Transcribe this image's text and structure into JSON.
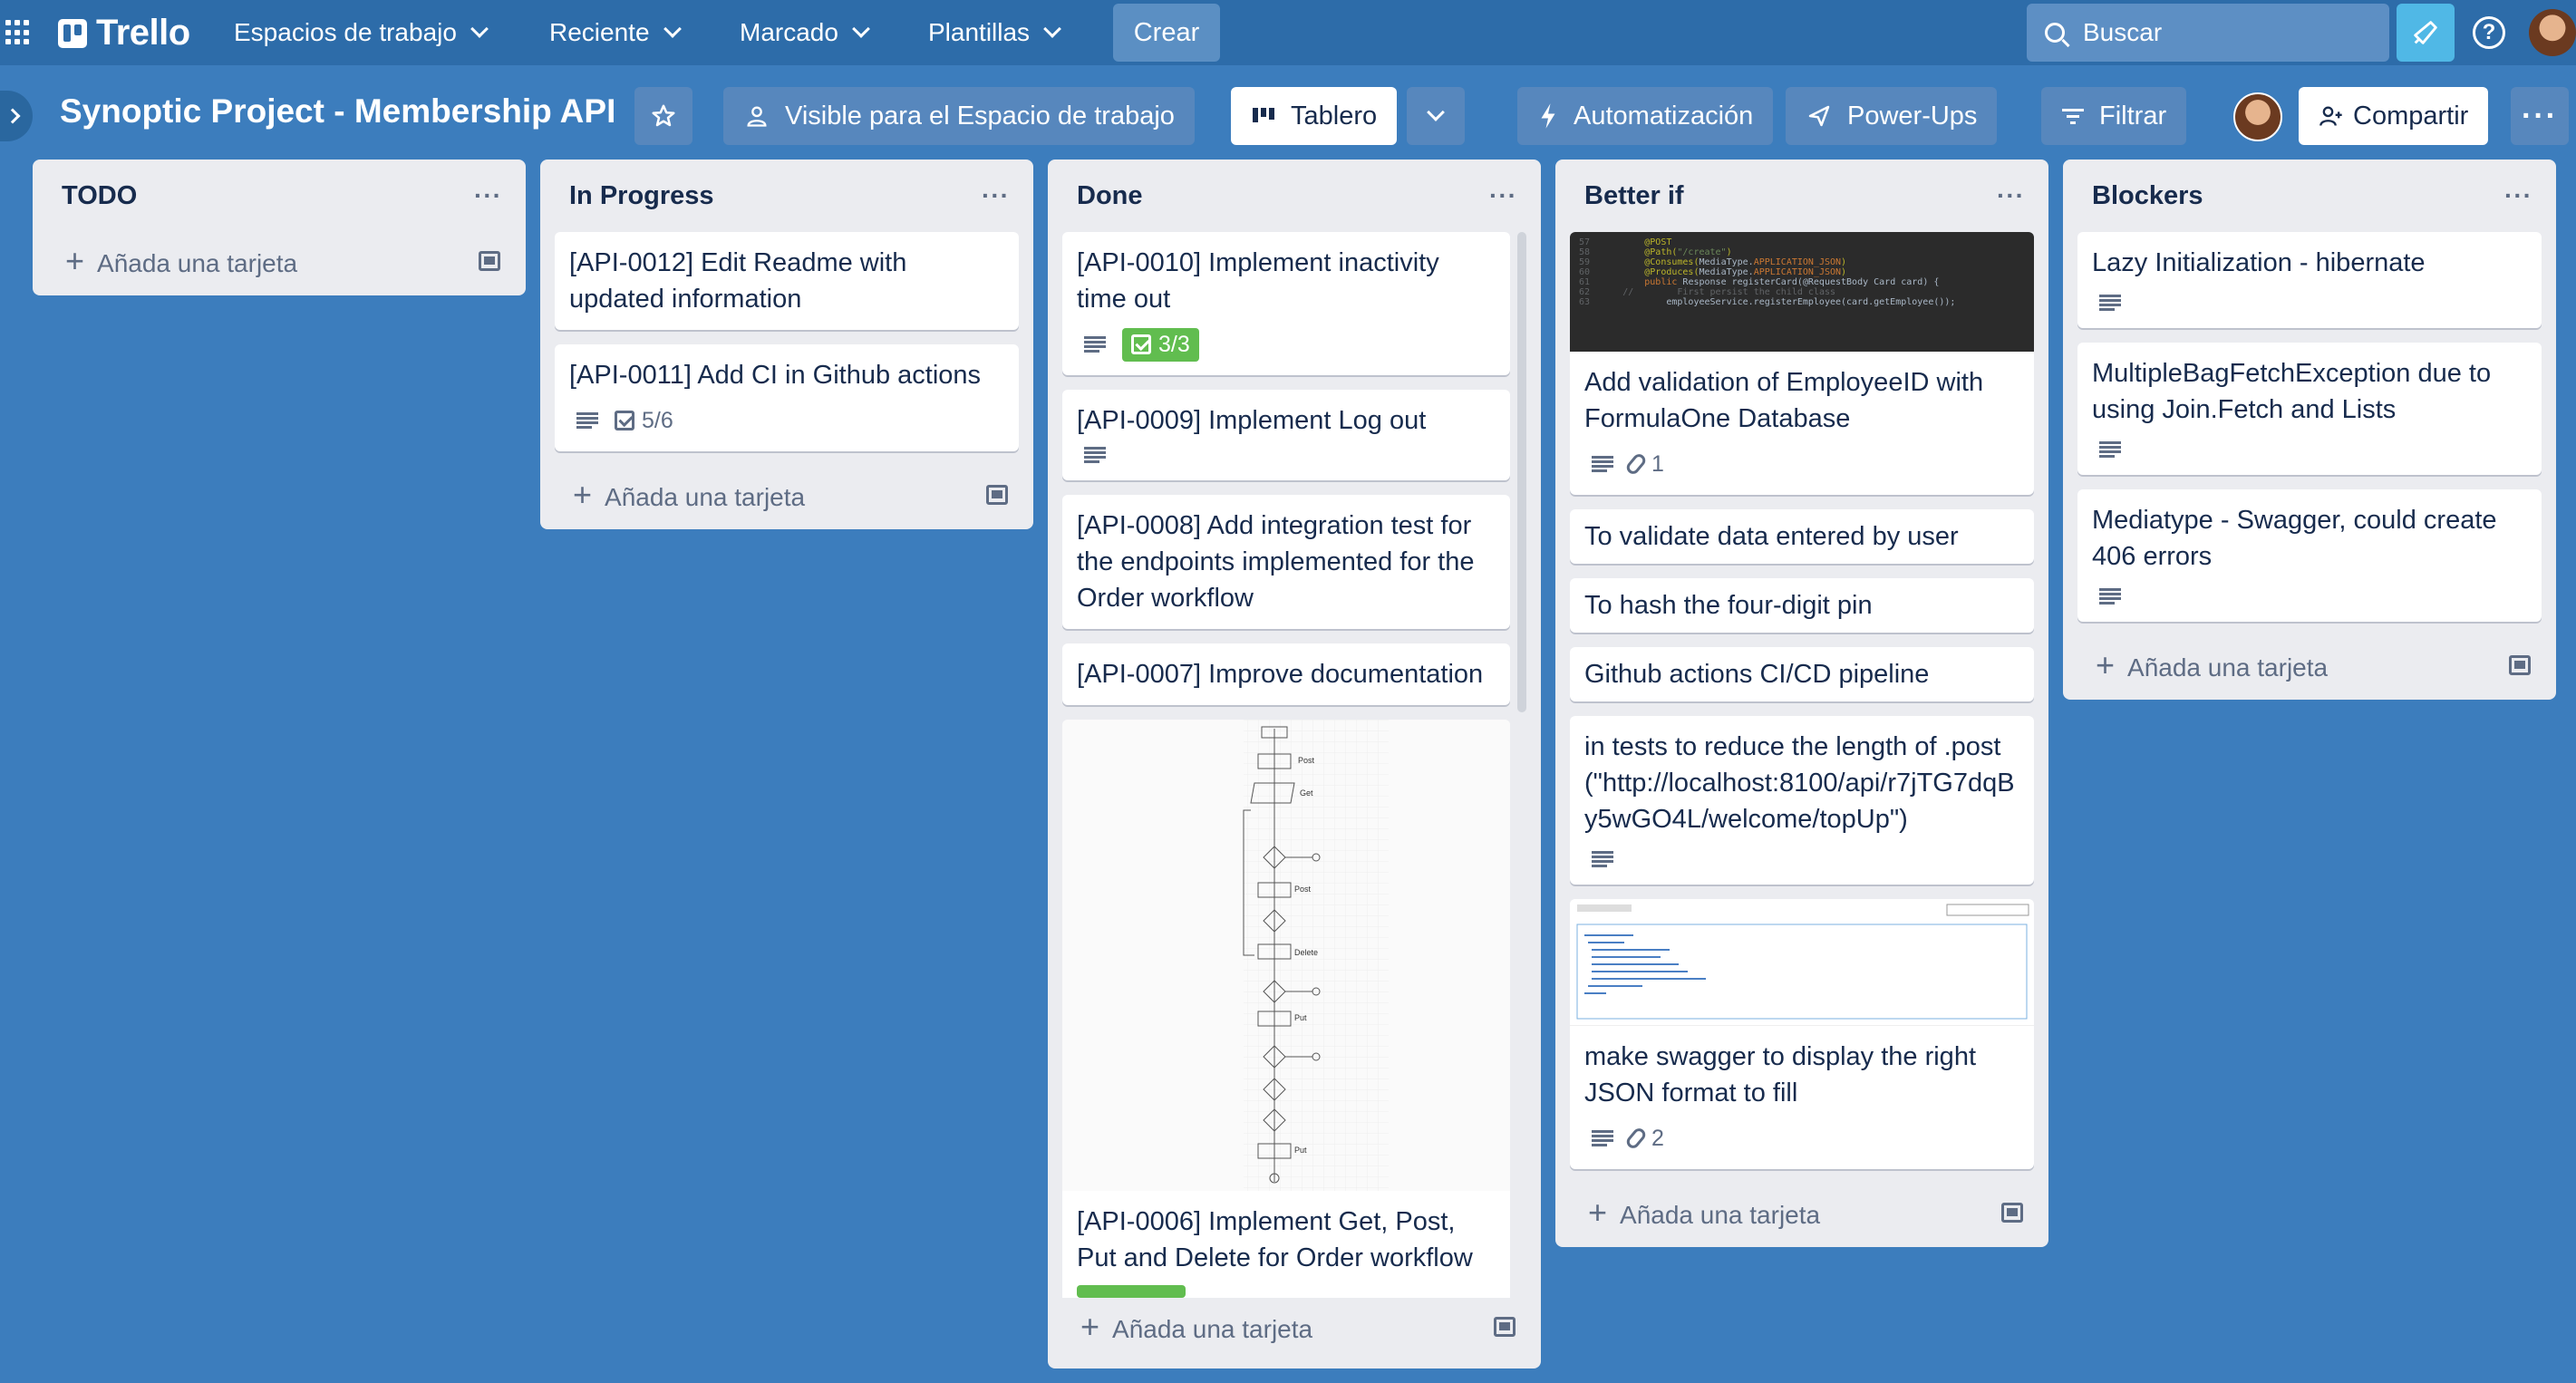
{
  "topnav": {
    "logo": "Trello",
    "menus": [
      "Espacios de trabajo",
      "Reciente",
      "Marcado",
      "Plantillas"
    ],
    "create_label": "Crear",
    "search_placeholder": "Buscar"
  },
  "board": {
    "title": "Synoptic Project - Membership API",
    "visibility_label": "Visible para el Espacio de trabajo",
    "view_label": "Tablero",
    "automation_label": "Automatización",
    "powerups_label": "Power-Ups",
    "filter_label": "Filtrar",
    "share_label": "Compartir"
  },
  "add_card_label": "Añada una tarjeta",
  "lists": [
    {
      "title": "TODO",
      "cards": []
    },
    {
      "title": "In Progress",
      "cards": [
        {
          "text": "[API-0012] Edit Readme with updated information"
        },
        {
          "text": "[API-0011] Add CI in Github actions",
          "checklist": "5/6"
        }
      ]
    },
    {
      "title": "Done",
      "cards": [
        {
          "text": "[API-0010] Implement inactivity time out",
          "checklist": "3/3"
        },
        {
          "text": "[API-0009] Implement Log out"
        },
        {
          "text": "[API-0008] Add integration test for the endpoints implemented for the Order workflow"
        },
        {
          "text": "[API-0007] Improve documentation"
        },
        {
          "text": "[API-0006] Implement Get, Post, Put and Delete for Order workflow",
          "cover_labels": [
            "Post",
            "Get",
            "Post",
            "Delete",
            "Put",
            "Put"
          ]
        }
      ]
    },
    {
      "title": "Better if",
      "cards": [
        {
          "text": "Add validation of EmployeeID with FormulaOne Database",
          "attachments": "1"
        },
        {
          "text": "To validate data entered by user"
        },
        {
          "text": "To hash the four-digit pin"
        },
        {
          "text": "Github actions CI/CD pipeline"
        },
        {
          "text": "in tests to reduce the length of .post(\"http://localhost:8100/api/r7jTG7dqBy5wGO4L/welcome/topUp\")"
        },
        {
          "text": "make swagger to display the right JSON format to fill",
          "attachments": "2"
        }
      ]
    },
    {
      "title": "Blockers",
      "cards": [
        {
          "text": "Lazy Initialization - hibernate"
        },
        {
          "text": "MultipleBagFetchException due to using Join.Fetch and Lists"
        },
        {
          "text": "Mediatype - Swagger, could create 406 errors"
        }
      ]
    }
  ],
  "colors": {
    "board_bg": "#3c7dbd",
    "topnav_bg": "#2d6ca9",
    "list_bg": "#ebecf0",
    "checklist_done": "#61bd4f"
  }
}
